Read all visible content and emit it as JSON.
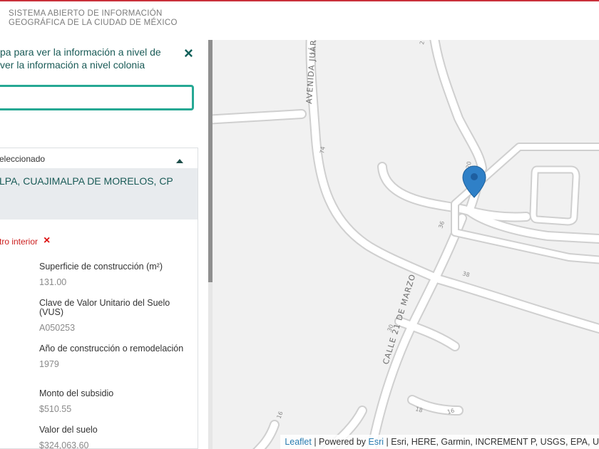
{
  "header": {
    "title_line1": "SISTEMA ABIERTO DE INFORMACIÓN",
    "title_line2": "GEOGRÁFICA DE LA CIUDAD DE MÉXICO"
  },
  "panel": {
    "intro_line1": "pa para ver la información a nivel de",
    "intro_line2": "ver la información a nivel colonia",
    "close_icon": "×",
    "search": {
      "value": "",
      "placeholder": ""
    },
    "selected_label": "eleccionado",
    "address": "LPA, CUAJIMALPA DE MORELOS, CP",
    "warning": "tro interior",
    "warning_icon": "×",
    "fields": [
      {
        "label": "Superficie de construcción (m²)",
        "value": "131.00"
      },
      {
        "label": "Clave de Valor Unitario del Suelo (VUS)",
        "value": "A050253"
      },
      {
        "label": "Año de construcción o remodelación",
        "value": "1979"
      },
      {
        "label": "Monto del subsidio",
        "value": "$510.55"
      },
      {
        "label": "Valor del suelo",
        "value": "$324,063.60"
      }
    ]
  },
  "map": {
    "streets": [
      {
        "name": "AVENIDA JUÁREZ"
      },
      {
        "name": "CALLE 21 DE MARZO"
      }
    ],
    "numbers": [
      "34",
      "2",
      "74",
      "20",
      "36",
      "38",
      "30",
      "16",
      "18",
      "16"
    ],
    "attribution": {
      "leaflet": "Leaflet",
      "sep": " | Powered by ",
      "esri": "Esri",
      "rest": " | Esri, HERE, Garmin, INCREMENT P, USGS, EPA, U"
    },
    "marker_color": "#2f80c7"
  }
}
